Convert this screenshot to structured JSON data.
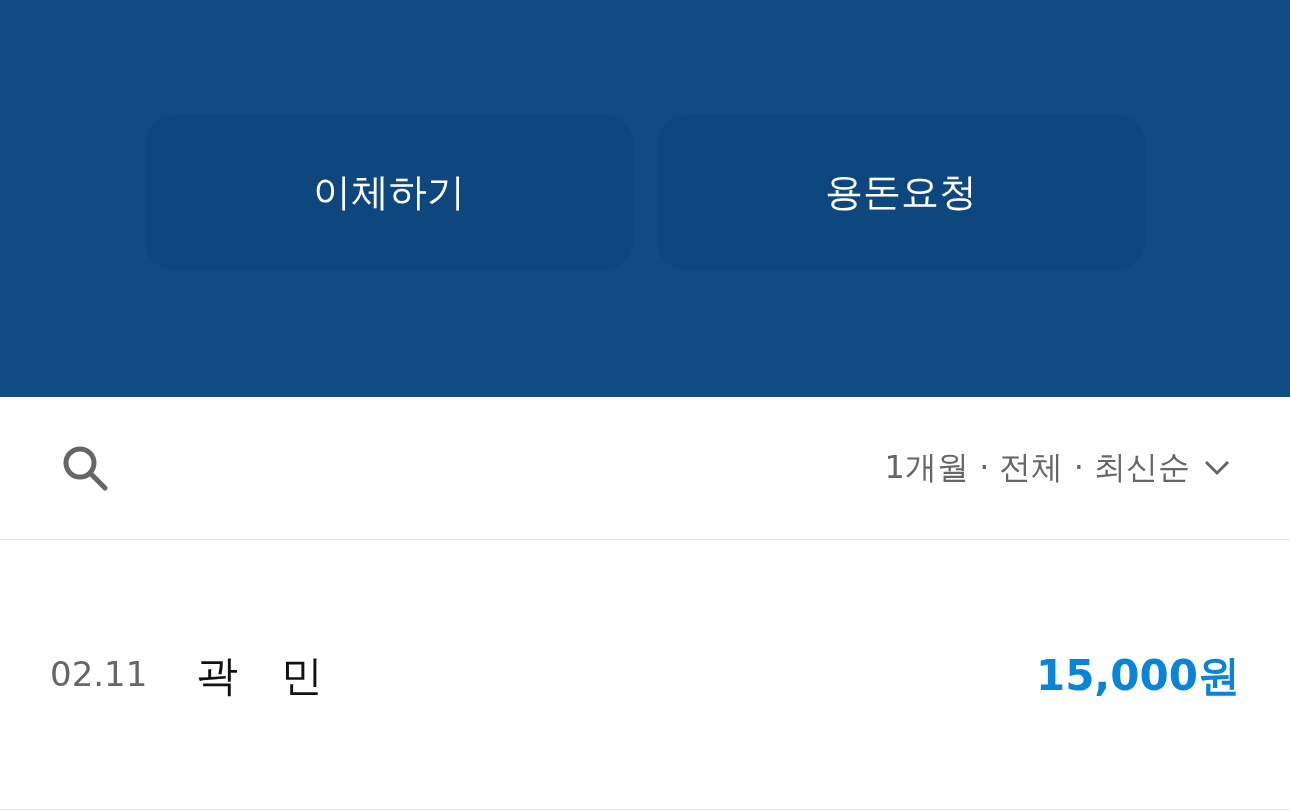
{
  "actions": [
    {
      "label": "이체하기"
    },
    {
      "label": "용돈요청"
    }
  ],
  "filter": {
    "label": "1개월 · 전체 · 최신순"
  },
  "transactions": [
    {
      "date": "02.11",
      "name": "곽 민",
      "amount": "15,000원"
    }
  ]
}
